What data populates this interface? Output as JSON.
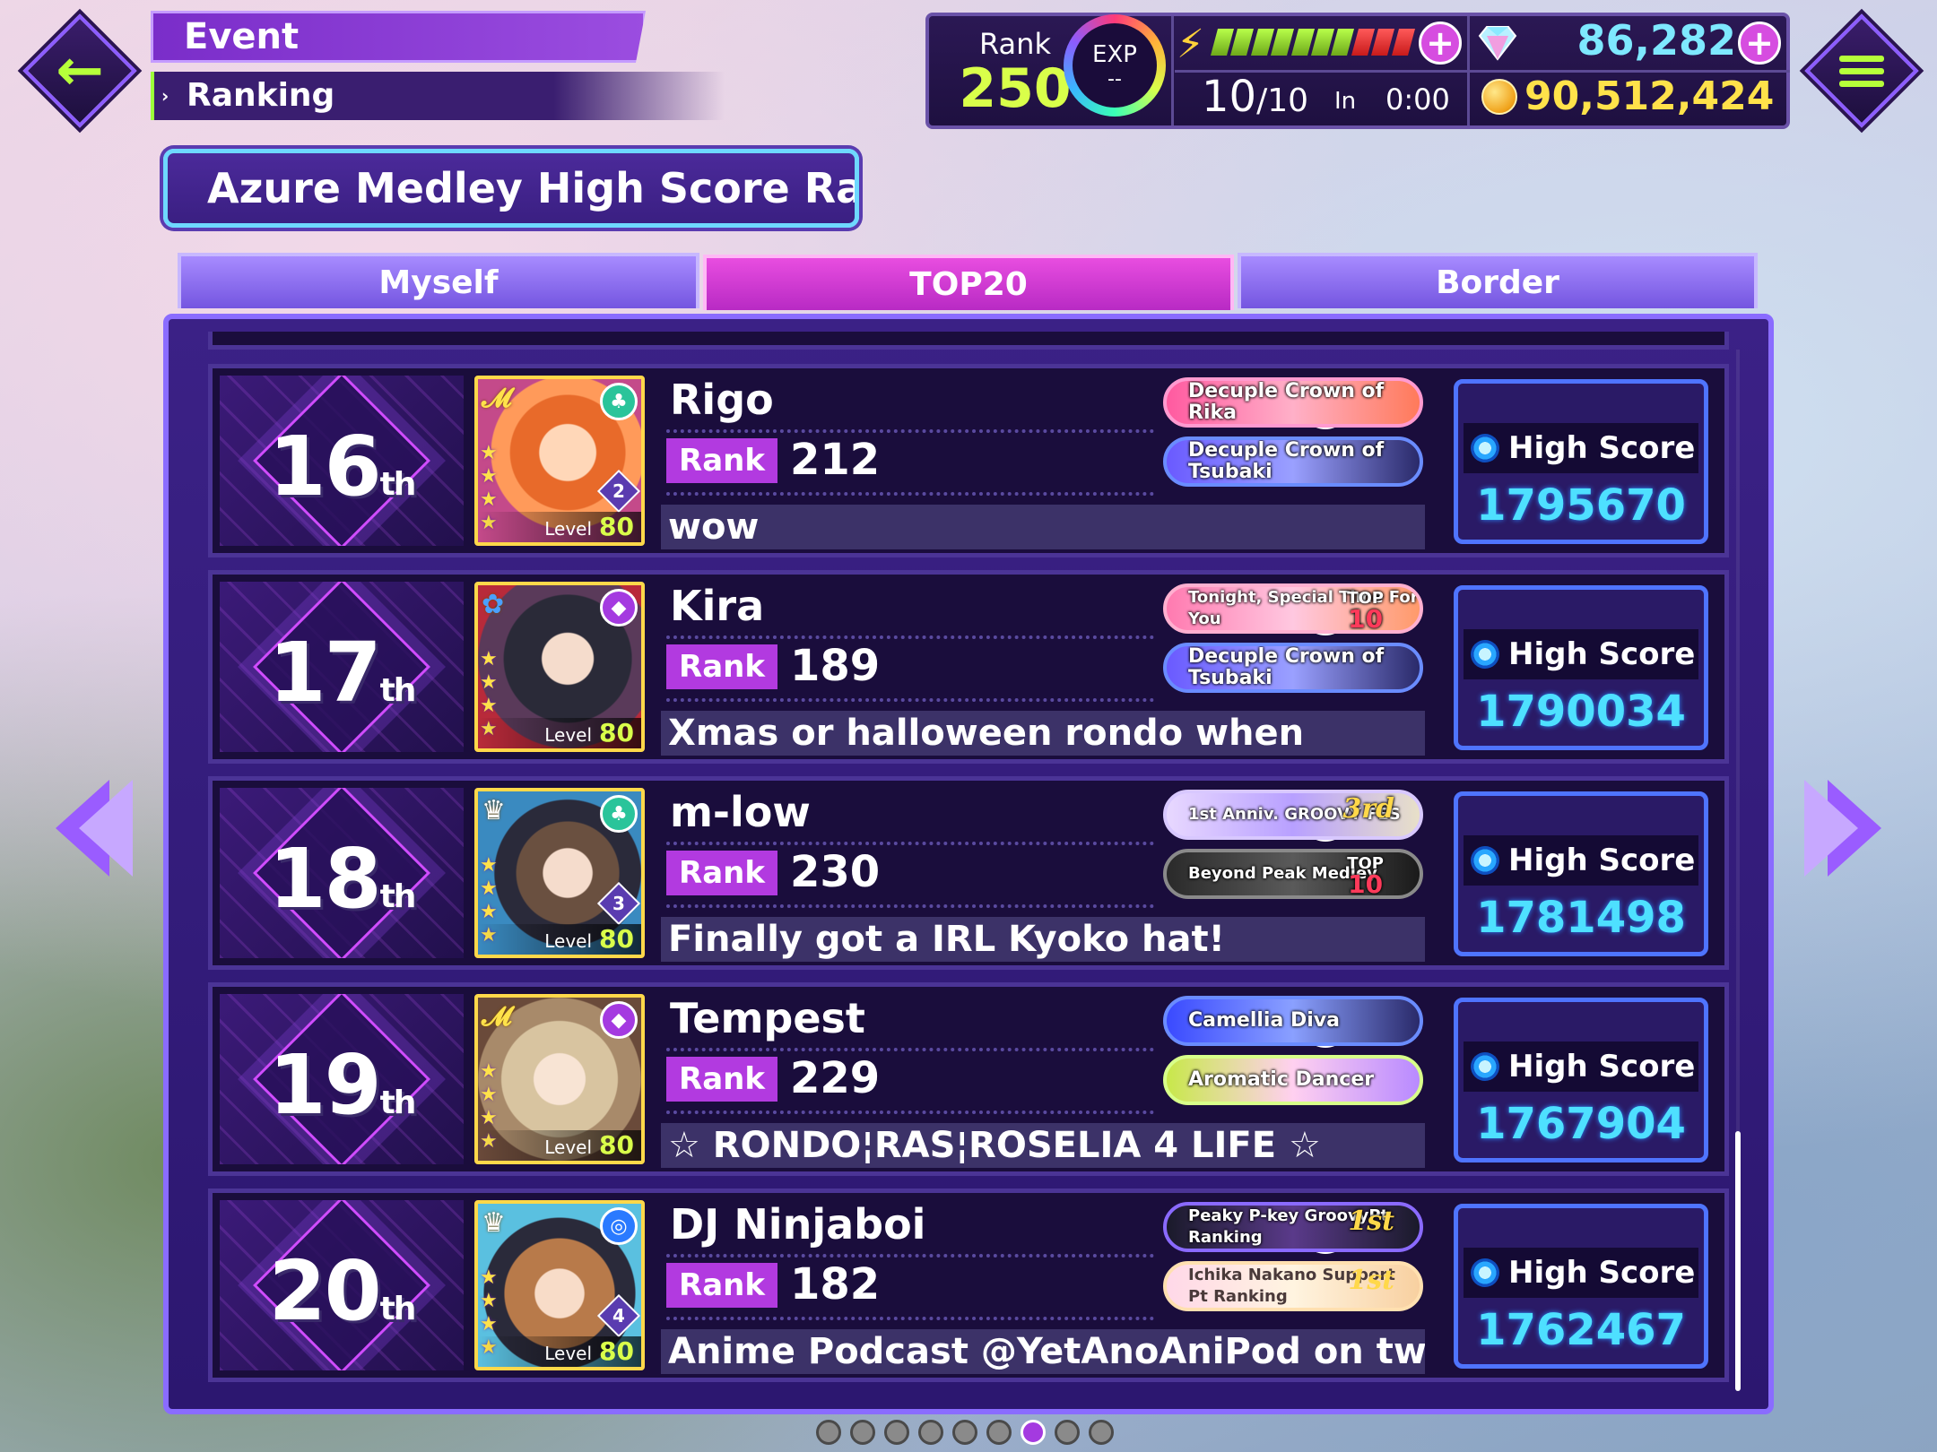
{
  "header": {
    "breadcrumb_event": "Event",
    "breadcrumb_ranking": "Ranking",
    "player_rank_label": "Rank",
    "player_rank": "250",
    "exp_label": "EXP",
    "exp_value": "--",
    "stamina_current": "10",
    "stamina_max": "/10",
    "stamina_in_label": "In",
    "stamina_timer": "0:00",
    "gems": "86,282",
    "coins": "90,512,424"
  },
  "title": "Azure Medley High Score Ranking",
  "tabs": [
    "Myself",
    "TOP20",
    "Border"
  ],
  "active_tab": "TOP20",
  "score_label": "High Score",
  "rank_tag": "Rank",
  "entries": [
    {
      "place": "16",
      "suffix": "th",
      "name": "Rigo",
      "rank": "212",
      "comment": "wow",
      "score": "1795670",
      "card_level_label": "Level",
      "card_level": "80",
      "master_rank": "2",
      "badges": [
        {
          "text": "Decuple Crown of Rika",
          "extra": ""
        },
        {
          "text": "Decuple Crown of Tsubaki",
          "extra": ""
        }
      ]
    },
    {
      "place": "17",
      "suffix": "th",
      "name": "Kira",
      "rank": "189",
      "comment": "Xmas or halloween rondo when",
      "score": "1790034",
      "card_level_label": "Level",
      "card_level": "80",
      "master_rank": "",
      "badges": [
        {
          "text": "Tonight, Special Time For You",
          "extra_top": "TOP",
          "extra": "10"
        },
        {
          "text": "Decuple Crown of Tsubaki",
          "extra": ""
        }
      ]
    },
    {
      "place": "18",
      "suffix": "th",
      "name": "m-low",
      "rank": "230",
      "comment": "Finally got a IRL Kyoko hat!",
      "score": "1781498",
      "card_level_label": "Level",
      "card_level": "80",
      "master_rank": "3",
      "badges": [
        {
          "text": "1st Anniv. GROOVY FES",
          "extra": "3rd"
        },
        {
          "text": "Beyond Peak Medley",
          "extra_top": "TOP",
          "extra": "10"
        }
      ]
    },
    {
      "place": "19",
      "suffix": "th",
      "name": "Tempest",
      "rank": "229",
      "comment": "☆ RONDO¦RAS¦ROSELIA 4 LIFE ☆",
      "score": "1767904",
      "card_level_label": "Level",
      "card_level": "80",
      "master_rank": "",
      "badges": [
        {
          "text": "Camellia Diva",
          "extra": ""
        },
        {
          "text": "Aromatic Dancer",
          "extra": ""
        }
      ]
    },
    {
      "place": "20",
      "suffix": "th",
      "name": "DJ Ninjaboi",
      "rank": "182",
      "comment": "Anime Podcast @YetAnoAniPod on twt",
      "score": "1762467",
      "card_level_label": "Level",
      "card_level": "80",
      "master_rank": "4",
      "badges": [
        {
          "text": "Peaky P-key GroovyPt Ranking",
          "extra": "1st"
        },
        {
          "text": "Ichika Nakano Support Pt Ranking",
          "extra": "1st"
        }
      ]
    }
  ],
  "colors": {
    "accent": "#b23ae0",
    "score_text": "#4ee0ff",
    "highlight_green": "#d9ff4a"
  },
  "pager": {
    "total": 9,
    "active": 7
  }
}
